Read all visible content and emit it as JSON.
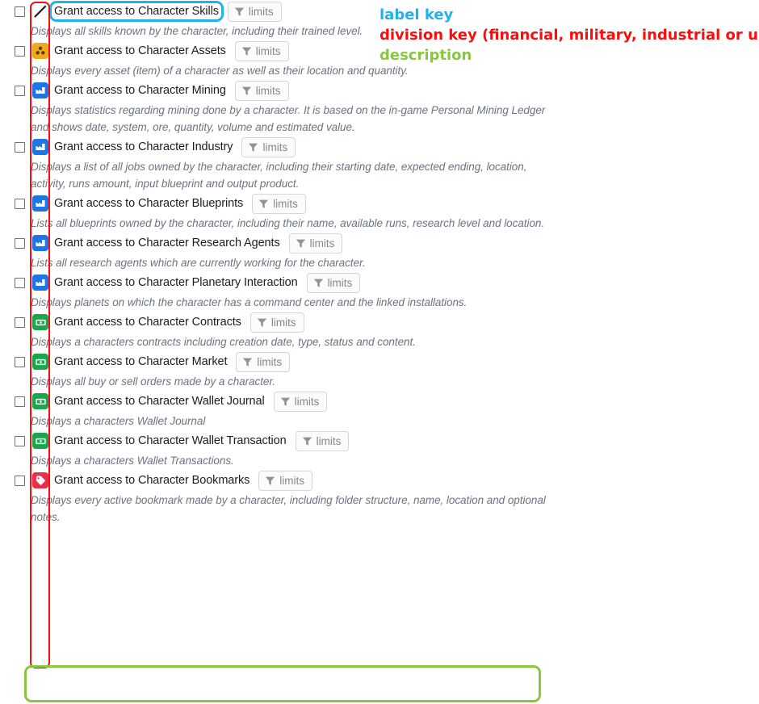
{
  "annotations": {
    "legend": [
      {
        "text": "label key",
        "color": "#22b0ee",
        "name": "label-key"
      },
      {
        "text": "division key (financial, military, industrial or unset)",
        "color": "#fb0d0d",
        "name": "division-key"
      },
      {
        "text": "description",
        "color": "#8bc63f",
        "name": "description-key"
      }
    ]
  },
  "limits_button": {
    "label": "limits",
    "icon": "funnel-icon"
  },
  "scopes": [
    {
      "label": "Grant access to Character Skills",
      "description": "Displays all skills known by the character, including their trained level.",
      "division": "unset",
      "icon": "pencil-icon",
      "checked": false,
      "highlighted_label": true
    },
    {
      "label": "Grant access to Character Assets",
      "description": "Displays every asset (item) of a character as well as their location and quantity.",
      "division": "asset",
      "icon": "assets-icon",
      "checked": false,
      "highlighted_label": false
    },
    {
      "label": "Grant access to Character Mining",
      "description": "Displays statistics regarding mining done by a character. It is based on the in-game Personal Mining Ledger and shows date, system, ore, quantity, volume and estimated value.",
      "division": "industrial",
      "icon": "industry-icon",
      "checked": false,
      "highlighted_label": false
    },
    {
      "label": "Grant access to Character Industry",
      "description": "Displays a list of all jobs owned by the character, including their starting date, expected ending, location, activity, runs amount, input blueprint and output product.",
      "division": "industrial",
      "icon": "industry-icon",
      "checked": false,
      "highlighted_label": false
    },
    {
      "label": "Grant access to Character Blueprints",
      "description": "Lists all blueprints owned by the character, including their name, available runs, research level and location.",
      "division": "industrial",
      "icon": "industry-icon",
      "checked": false,
      "highlighted_label": false
    },
    {
      "label": "Grant access to Character Research Agents",
      "description": "Lists all research agents which are currently working for the character.",
      "division": "industrial",
      "icon": "industry-icon",
      "checked": false,
      "highlighted_label": false
    },
    {
      "label": "Grant access to Character Planetary Interaction",
      "description": "Displays planets on which the character has a command center and the linked installations.",
      "division": "industrial",
      "icon": "industry-icon",
      "checked": false,
      "highlighted_label": false
    },
    {
      "label": "Grant access to Character Contracts",
      "description": "Displays a characters contracts including creation date, type, status and content.",
      "division": "financial",
      "icon": "money-icon",
      "checked": false,
      "highlighted_label": false
    },
    {
      "label": "Grant access to Character Market",
      "description": "Displays all buy or sell orders made by a character.",
      "division": "financial",
      "icon": "money-icon",
      "checked": false,
      "highlighted_label": false
    },
    {
      "label": "Grant access to Character Wallet Journal",
      "description": "Displays a characters Wallet Journal",
      "division": "financial",
      "icon": "money-icon",
      "checked": false,
      "highlighted_label": false
    },
    {
      "label": "Grant access to Character Wallet Transaction",
      "description": "Displays a characters Wallet Transactions.",
      "division": "financial",
      "icon": "money-icon",
      "checked": false,
      "highlighted_label": false
    },
    {
      "label": "Grant access to Character Bookmarks",
      "description": "Displays every active bookmark made by a character, including folder structure, name, location and optional notes.",
      "division": "bookmark",
      "icon": "bookmark-icon",
      "checked": false,
      "highlighted_label": false,
      "highlighted_description": true
    }
  ]
}
